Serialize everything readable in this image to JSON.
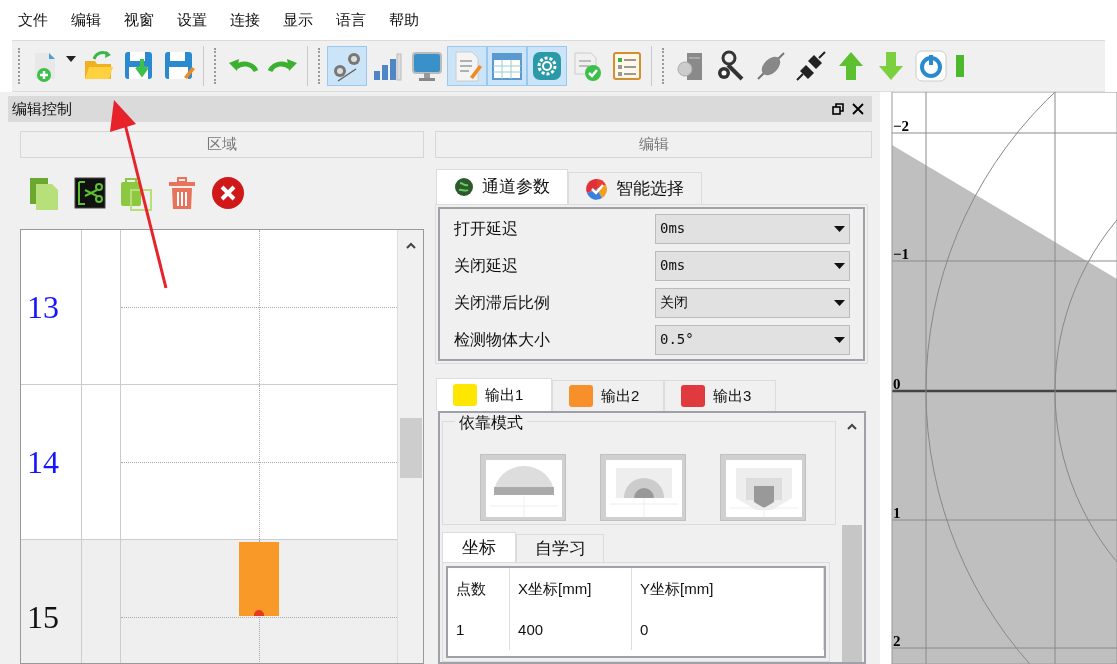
{
  "menu": [
    "文件",
    "编辑",
    "视窗",
    "设置",
    "连接",
    "显示",
    "语言",
    "帮助"
  ],
  "toolbar": [
    [
      {
        "kind": "new",
        "selected": false
      },
      {
        "kind": "open",
        "selected": false
      },
      {
        "kind": "save",
        "selected": false
      },
      {
        "kind": "save_as",
        "selected": false
      }
    ],
    [
      {
        "kind": "undo",
        "selected": false
      },
      {
        "kind": "redo",
        "selected": false
      }
    ],
    [
      {
        "kind": "route",
        "selected": true
      },
      {
        "kind": "bars",
        "selected": false
      },
      {
        "kind": "monitor",
        "selected": false
      },
      {
        "kind": "doc_edit",
        "selected": true
      },
      {
        "kind": "table",
        "selected": true
      },
      {
        "kind": "gear_app",
        "selected": true
      },
      {
        "kind": "doc_check",
        "selected": false
      },
      {
        "kind": "list",
        "selected": false
      }
    ],
    [
      {
        "kind": "server",
        "selected": false
      },
      {
        "kind": "tools",
        "selected": false
      },
      {
        "kind": "plug",
        "selected": false
      },
      {
        "kind": "unplug",
        "selected": false
      },
      {
        "kind": "upload",
        "selected": false
      },
      {
        "kind": "download",
        "selected": false
      },
      {
        "kind": "power",
        "selected": false
      },
      {
        "kind": "green_block",
        "selected": false
      }
    ]
  ],
  "panel": {
    "title": "编辑控制",
    "zones": {
      "header": "区域",
      "tools": [
        {
          "kind": "copy"
        },
        {
          "kind": "cut"
        },
        {
          "kind": "paste"
        },
        {
          "kind": "delete"
        },
        {
          "kind": "close"
        }
      ],
      "rows": [
        {
          "label": "13",
          "selected": false,
          "marker": false
        },
        {
          "label": "14",
          "selected": false,
          "marker": false
        },
        {
          "label": "15",
          "selected": true,
          "marker": true
        }
      ]
    },
    "edit": {
      "header": "编辑",
      "tabs": [
        {
          "label": "通道参数",
          "selected": true
        },
        {
          "label": "智能选择",
          "selected": false
        }
      ],
      "params": [
        {
          "label": "打开延迟",
          "value": "0ms"
        },
        {
          "label": "关闭延迟",
          "value": "0ms"
        },
        {
          "label": "关闭滞后比例",
          "value": "关闭"
        },
        {
          "label": "检测物体大小",
          "value": "0.5°"
        }
      ],
      "output_tabs": [
        {
          "label": "输出1",
          "color": "#ffe600",
          "selected": true
        },
        {
          "label": "输出2",
          "color": "#f7902b",
          "selected": false
        },
        {
          "label": "输出3",
          "color": "#e0393e",
          "selected": false
        }
      ],
      "mode_group": {
        "title": "依靠模式",
        "options": [
          {
            "kind": "semicircle"
          },
          {
            "kind": "arch"
          },
          {
            "kind": "pentagon"
          }
        ]
      },
      "subtabs": [
        {
          "label": "坐标",
          "selected": true
        },
        {
          "label": "自学习",
          "selected": false
        }
      ],
      "table": {
        "columns": [
          "点数",
          "X坐标[mm]",
          "Y坐标[mm]"
        ],
        "rows": [
          [
            "1",
            "400",
            "0"
          ]
        ]
      }
    }
  },
  "plot": {
    "tick_labels": [
      "−2",
      "−1",
      "0",
      "1",
      "2"
    ]
  }
}
